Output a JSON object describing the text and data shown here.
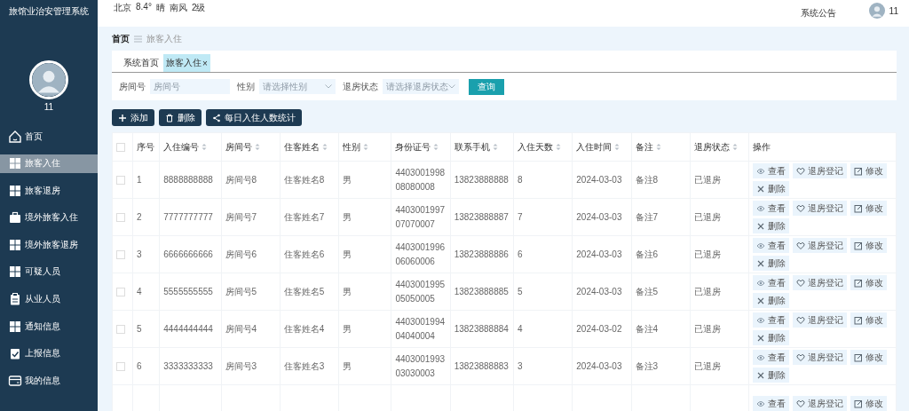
{
  "sidebar": {
    "title": "旅馆业治安管理系统",
    "user_name": "11",
    "items": [
      {
        "label": "首页",
        "kind": "home",
        "selected": false
      },
      {
        "label": "旅客入住",
        "kind": "grid",
        "selected": true
      },
      {
        "label": "旅客退房",
        "kind": "grid",
        "selected": false
      },
      {
        "label": "境外旅客入住",
        "kind": "briefcase",
        "selected": false
      },
      {
        "label": "境外旅客退房",
        "kind": "grid",
        "selected": false
      },
      {
        "label": "可疑人员",
        "kind": "grid",
        "selected": false
      },
      {
        "label": "从业人员",
        "kind": "clipboard",
        "selected": false
      },
      {
        "label": "通知信息",
        "kind": "grid",
        "selected": false
      },
      {
        "label": "上报信息",
        "kind": "report",
        "selected": false
      },
      {
        "label": "我的信息",
        "kind": "card",
        "selected": false
      }
    ]
  },
  "topbar": {
    "weather": [
      "北京",
      "8.4°",
      "晴",
      "南风",
      "2级"
    ],
    "notice": "系统公告",
    "user_name": "11"
  },
  "breadcrumb": [
    "首页",
    "旅客入住"
  ],
  "tabs": [
    {
      "label": "系统首页",
      "selected": false
    },
    {
      "label": "旅客入住",
      "selected": true,
      "close": "×"
    }
  ],
  "filters": [
    {
      "label": "房间号",
      "kind": "input",
      "placeholder": "房间号"
    },
    {
      "label": "性别",
      "kind": "select",
      "placeholder": "请选择性别"
    },
    {
      "label": "退房状态",
      "kind": "select",
      "placeholder": "请选择退房状态"
    }
  ],
  "search_button": "查询",
  "actions": [
    {
      "label": "添加",
      "kind": "add"
    },
    {
      "label": "删除",
      "kind": "delete"
    },
    {
      "label": "每日入住人数统计",
      "kind": "stats"
    }
  ],
  "table": {
    "all_checked": false,
    "columns": [
      {
        "label": "序号",
        "sortable": false
      },
      {
        "label": "入住编号",
        "sortable": true
      },
      {
        "label": "房间号",
        "sortable": true
      },
      {
        "label": "住客姓名",
        "sortable": true
      },
      {
        "label": "性别",
        "sortable": true
      },
      {
        "label": "身份证号",
        "sortable": true
      },
      {
        "label": "联系手机",
        "sortable": true
      },
      {
        "label": "入住天数",
        "sortable": true
      },
      {
        "label": "入住时间",
        "sortable": true
      },
      {
        "label": "备注",
        "sortable": true
      },
      {
        "label": "退房状态",
        "sortable": true
      },
      {
        "label": "操作",
        "sortable": false
      }
    ],
    "rows": [
      {
        "checked": false,
        "cells": [
          "1",
          "8888888888",
          "房间号8",
          "住客姓名8",
          "男",
          "440300199808080008",
          "13823888888",
          "8",
          "2024-03-03",
          "备注8",
          "已退房"
        ],
        "actions": [
          {
            "label": "查看",
            "kind": "view"
          },
          {
            "label": "退房登记",
            "kind": "checkout"
          },
          {
            "label": "修改",
            "kind": "edit"
          },
          {
            "label": "删除",
            "kind": "delete"
          }
        ]
      },
      {
        "checked": false,
        "cells": [
          "2",
          "7777777777",
          "房间号7",
          "住客姓名7",
          "男",
          "440300199707070007",
          "13823888887",
          "7",
          "2024-03-03",
          "备注7",
          "已退房"
        ],
        "actions": [
          {
            "label": "查看",
            "kind": "view"
          },
          {
            "label": "退房登记",
            "kind": "checkout"
          },
          {
            "label": "修改",
            "kind": "edit"
          },
          {
            "label": "删除",
            "kind": "delete"
          }
        ]
      },
      {
        "checked": false,
        "cells": [
          "3",
          "6666666666",
          "房间号6",
          "住客姓名6",
          "男",
          "440300199606060006",
          "13823888886",
          "6",
          "2024-03-03",
          "备注6",
          "已退房"
        ],
        "actions": [
          {
            "label": "查看",
            "kind": "view"
          },
          {
            "label": "退房登记",
            "kind": "checkout"
          },
          {
            "label": "修改",
            "kind": "edit"
          },
          {
            "label": "删除",
            "kind": "delete"
          }
        ]
      },
      {
        "checked": false,
        "cells": [
          "4",
          "5555555555",
          "房间号5",
          "住客姓名5",
          "男",
          "440300199505050005",
          "13823888885",
          "5",
          "2024-03-03",
          "备注5",
          "已退房"
        ],
        "actions": [
          {
            "label": "查看",
            "kind": "view"
          },
          {
            "label": "退房登记",
            "kind": "checkout"
          },
          {
            "label": "修改",
            "kind": "edit"
          },
          {
            "label": "删除",
            "kind": "delete"
          }
        ]
      },
      {
        "checked": false,
        "cells": [
          "5",
          "4444444444",
          "房间号4",
          "住客姓名4",
          "男",
          "440300199404040004",
          "13823888884",
          "4",
          "2024-03-02",
          "备注4",
          "已退房"
        ],
        "actions": [
          {
            "label": "查看",
            "kind": "view"
          },
          {
            "label": "退房登记",
            "kind": "checkout"
          },
          {
            "label": "修改",
            "kind": "edit"
          },
          {
            "label": "删除",
            "kind": "delete"
          }
        ]
      },
      {
        "checked": false,
        "cells": [
          "6",
          "3333333333",
          "房间号3",
          "住客姓名3",
          "男",
          "440300199303030003",
          "13823888883",
          "3",
          "2024-03-03",
          "备注3",
          "已退房"
        ],
        "actions": [
          {
            "label": "查看",
            "kind": "view"
          },
          {
            "label": "退房登记",
            "kind": "checkout"
          },
          {
            "label": "修改",
            "kind": "edit"
          },
          {
            "label": "删除",
            "kind": "delete"
          }
        ]
      },
      {
        "actions": [
          {
            "label": "查看",
            "kind": "view"
          },
          {
            "label": "退房登记",
            "kind": "checkout"
          },
          {
            "label": "修改",
            "kind": "edit"
          }
        ]
      }
    ]
  }
}
